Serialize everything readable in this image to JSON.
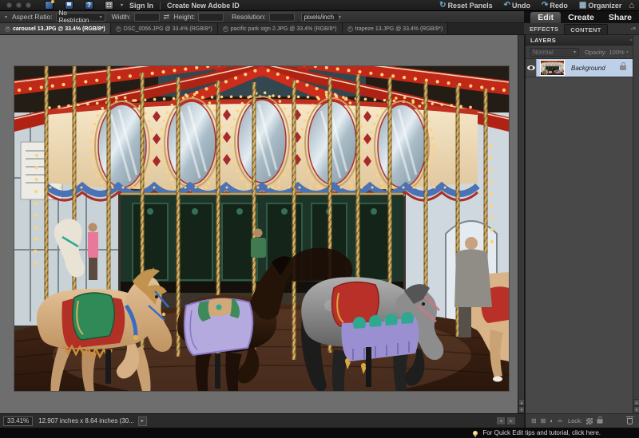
{
  "titlebar": {
    "sign_in": "Sign In",
    "create_adobe_id": "Create New Adobe ID",
    "reset_panels": "Reset Panels",
    "undo": "Undo",
    "redo": "Redo",
    "organizer": "Organizer"
  },
  "options_bar": {
    "aspect_ratio_label": "Aspect Ratio:",
    "aspect_ratio_value": "No Restriction",
    "width_label": "Width:",
    "width_value": "",
    "height_label": "Height:",
    "height_value": "",
    "resolution_label": "Resolution:",
    "resolution_value": "",
    "resolution_unit": "pixels/inch"
  },
  "document_tabs": [
    {
      "label": "carousel 13.JPG @ 33.4% (RGB/8*)",
      "active": true
    },
    {
      "label": "DSC_0066.JPG @ 33.4% (RGB/8*)",
      "active": false
    },
    {
      "label": "pacific park sign 2.JPG @ 33.4% (RGB/8*)",
      "active": false
    },
    {
      "label": "trapeze 13.JPG @ 33.4% (RGB/8*)",
      "active": false
    }
  ],
  "panel_bin": {
    "mode_tabs": {
      "edit": "Edit",
      "create": "Create",
      "share": "Share"
    },
    "effects_tab": "EFFECTS",
    "content_tab": "CONTENT",
    "layers_panel": {
      "title": "LAYERS",
      "blend_mode": "Normal",
      "opacity_label": "Opacity:",
      "opacity_value": "100%",
      "layer_name": "Background",
      "lock_label": "Lock:"
    }
  },
  "status_bar": {
    "zoom_level": "33.41%",
    "document_size": "12.907 inches x 8.64 inches (30..."
  },
  "tip_bar": {
    "message": "For Quick Edit tips and tutorial, click here."
  },
  "canvas": {
    "image_alt": "Photograph of an indoor carousel: red radiating ceiling beams strung with lights, an ornate cream rounding board with oval mirrors ringed by bulbs, twisted brass poles, and painted horses (tan, dark brown, dapple gray) on a wooden floor"
  },
  "icons": {
    "close": "×",
    "caret": "▾",
    "swap": "⇄",
    "collapse": "▾",
    "reset": "↻",
    "undo": "↶",
    "redo": "↷",
    "grid": "▦",
    "home": "⌂",
    "help": "?",
    "panel_menu": "-≡",
    "expand": "▸",
    "up": "▲",
    "down": "▼",
    "left": "◄",
    "right": "►",
    "new_layer": "⊞",
    "delete_layer": "⊠",
    "adjustment_layer": "◐",
    "link_layers": "∞"
  }
}
